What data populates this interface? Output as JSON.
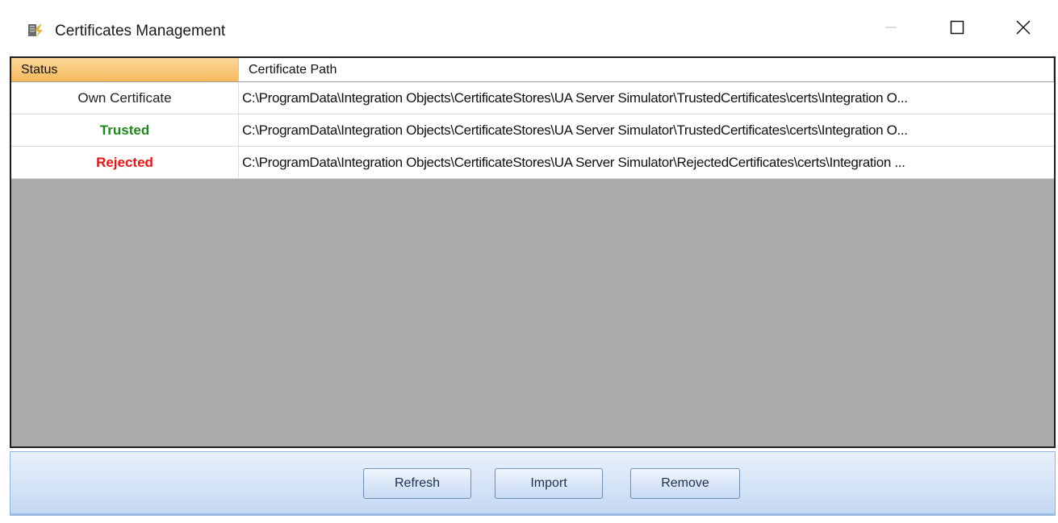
{
  "window": {
    "title": "Certificates Management",
    "icon": "certificate-icon"
  },
  "controls": {
    "minimize_icon": "minimize-icon",
    "maximize_icon": "maximize-icon",
    "close_icon": "close-icon"
  },
  "table": {
    "columns": [
      "Status",
      "Certificate Path"
    ],
    "rows": [
      {
        "status": "Own Certificate",
        "path": "C:\\ProgramData\\Integration Objects\\CertificateStores\\UA Server Simulator\\TrustedCertificates\\certs\\Integration O..."
      },
      {
        "status": "Trusted",
        "path": "C:\\ProgramData\\Integration Objects\\CertificateStores\\UA Server Simulator\\TrustedCertificates\\certs\\Integration O..."
      },
      {
        "status": "Rejected",
        "path": "C:\\ProgramData\\Integration Objects\\CertificateStores\\UA Server Simulator\\RejectedCertificates\\certs\\Integration ..."
      }
    ]
  },
  "buttons": {
    "refresh": "Refresh",
    "import": "Import",
    "remove": "Remove"
  },
  "colors": {
    "trusted": "#1b8a1b",
    "rejected": "#e81414",
    "header_selected": "#f6b95d",
    "empty_area": "#ababab"
  }
}
